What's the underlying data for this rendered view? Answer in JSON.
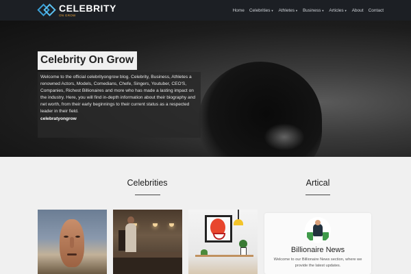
{
  "nav": {
    "logo_main": "CELEBRITY",
    "logo_sub": "ON GROW",
    "links": [
      "Home",
      "Celebrities",
      "Athletes",
      "Business",
      "Articles",
      "About",
      "Contact"
    ],
    "dropdowns": [
      false,
      true,
      true,
      true,
      true,
      false,
      false
    ]
  },
  "hero": {
    "title": "Celebrity On Grow",
    "description": "Welcome to the official celebrityongrow blog. Celebrity, Business, Athletes a renowned Actors, Models, Comedians, Chefe, Singers, Youtuber, CEO'S, Companies, Richest Billionaires and more who has made a lasting impact on the industry. Here, you will find in-depth information about their biography and net worth, from their early beginnings to their current status as a respected leader in their field.",
    "tag": "celebratyongrow"
  },
  "celebrities": {
    "heading": "Celebrities",
    "cards": [
      {
        "image": "theater-mask-image"
      },
      {
        "image": "office-people-image"
      },
      {
        "image": "clown-art-image"
      }
    ]
  },
  "articles": {
    "heading": "Artical",
    "card": {
      "title": "Billionaire News",
      "description": "Welcome to our Billionaire News section, where we provide the latest updates."
    }
  },
  "colors": {
    "nav_bg": "#1c1f24",
    "logo_accent": "#3aa0d8",
    "logo_sub": "#e6a23c",
    "section_bg": "#f0f0f0"
  }
}
